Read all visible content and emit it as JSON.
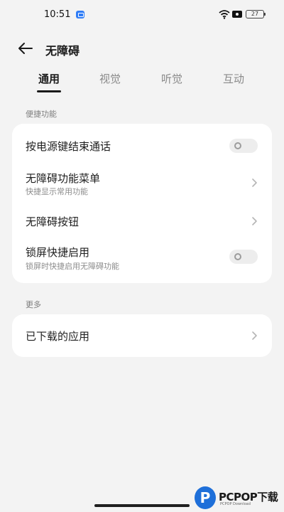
{
  "status_bar": {
    "time": "10:51",
    "battery": "27",
    "icons": [
      "app-notification-icon",
      "wifi-icon",
      "sim-icon",
      "battery-icon"
    ]
  },
  "header": {
    "title": "无障碍",
    "back_icon": "arrow-left-icon"
  },
  "tabs": [
    {
      "label": "通用",
      "active": true
    },
    {
      "label": "视觉",
      "active": false
    },
    {
      "label": "听觉",
      "active": false
    },
    {
      "label": "互动",
      "active": false
    }
  ],
  "sections": [
    {
      "header": "便捷功能",
      "items": [
        {
          "title": "按电源键结束通话",
          "control": "toggle",
          "on": false
        },
        {
          "title": "无障碍功能菜单",
          "subtitle": "快捷显示常用功能",
          "control": "chevron"
        },
        {
          "title": "无障碍按钮",
          "control": "chevron"
        },
        {
          "title": "锁屏快捷启用",
          "subtitle": "锁屏时快捷启用无障碍功能",
          "control": "toggle",
          "on": false
        }
      ]
    },
    {
      "header": "更多",
      "items": [
        {
          "title": "已下载的应用",
          "control": "chevron"
        }
      ]
    }
  ],
  "watermark": {
    "text": "PCPOP下载",
    "sub": "PCPOP Download"
  },
  "colors": {
    "background": "#f3f3f3",
    "card": "#ffffff",
    "text_primary": "#1f1f1f",
    "text_secondary": "#8c8c8c",
    "tab_inactive": "#8a8a8a"
  }
}
